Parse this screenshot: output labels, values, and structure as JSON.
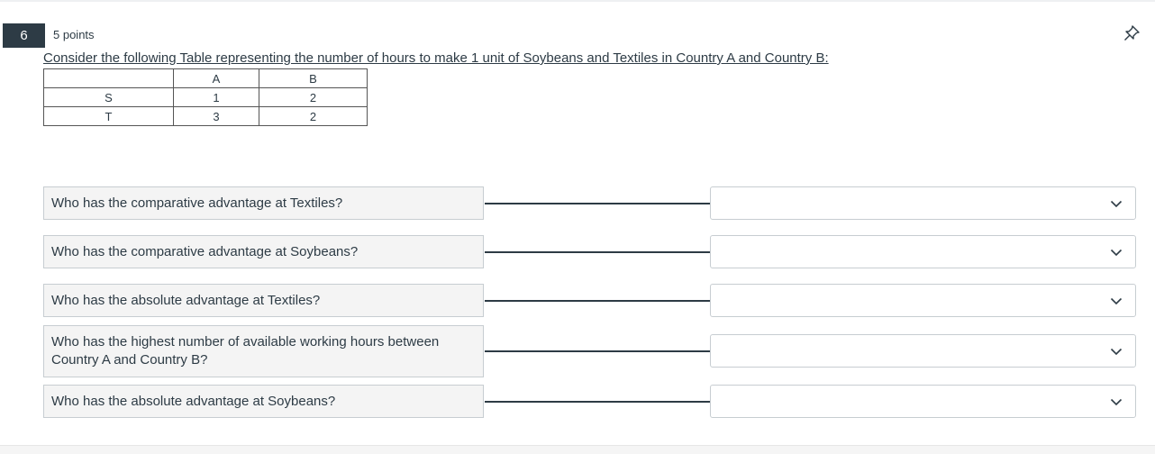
{
  "question": {
    "number": "6",
    "points": "5 points",
    "text": "Consider the following Table representing the number of hours to make 1 unit of Soybeans and Textiles in Country A and Country B:"
  },
  "table": {
    "header": [
      "",
      "A",
      "B"
    ],
    "rows": [
      [
        "S",
        "1",
        "2"
      ],
      [
        "T",
        "3",
        "2"
      ]
    ]
  },
  "matches": [
    {
      "prompt": "Who has the comparative advantage at Textiles?",
      "selected": ""
    },
    {
      "prompt": "Who has the comparative advantage at Soybeans?",
      "selected": ""
    },
    {
      "prompt": "Who has the absolute advantage at Textiles?",
      "selected": ""
    },
    {
      "prompt": "Who has the highest number of available working hours between Country A and Country B?",
      "selected": ""
    },
    {
      "prompt": "Who has the absolute advantage at Soybeans?",
      "selected": ""
    }
  ],
  "icons": {
    "pin": "pin-icon",
    "dropdown": "chevron-down-icon"
  },
  "colors": {
    "question_badge": "#2d3b45",
    "prompt_bg": "#f4f4f4",
    "border": "#c7cdd1"
  }
}
